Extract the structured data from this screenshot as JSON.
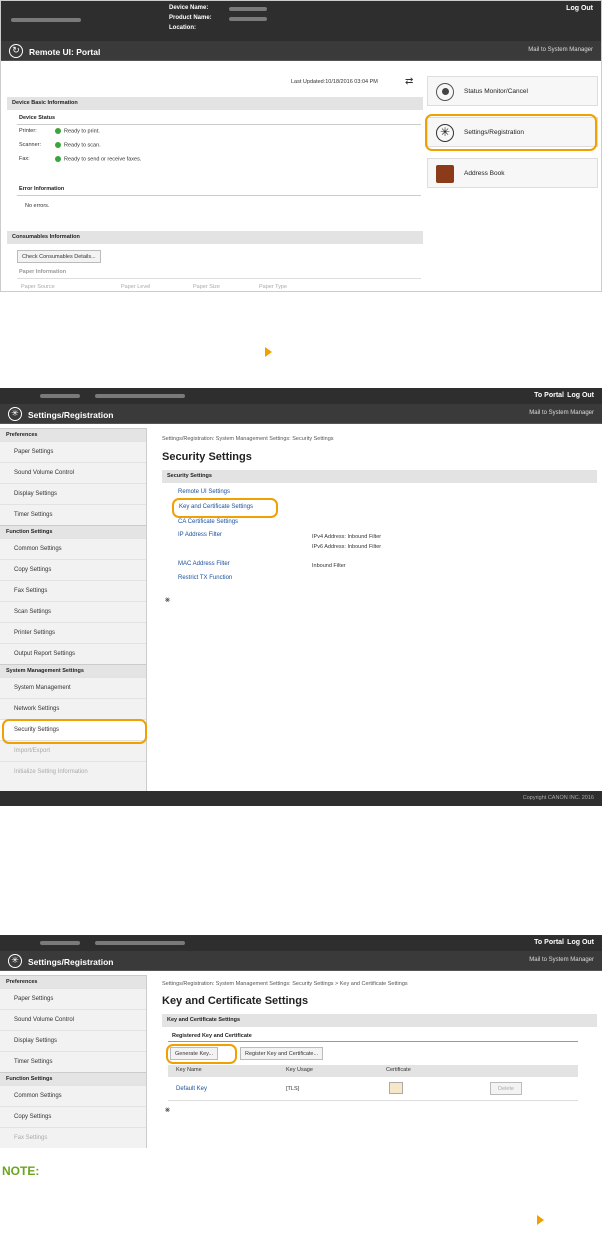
{
  "portal": {
    "device_name_label": "Device Name:",
    "product_name_label": "Product Name:",
    "location_label": "Location:",
    "logout": "Log Out",
    "title": "Remote UI: Portal",
    "mail": "Mail to System Manager",
    "last_updated": "Last Updated:10/18/2016 03:04 PM",
    "device_basic_info": "Device Basic Information",
    "device_status": "Device Status",
    "printer_label": "Printer:",
    "printer_status": "Ready to print.",
    "scanner_label": "Scanner:",
    "scanner_status": "Ready to scan.",
    "fax_label": "Fax:",
    "fax_status": "Ready to send or receive faxes.",
    "error_info": "Error Information",
    "no_errors": "No errors.",
    "consumables_info": "Consumables Information",
    "check_consumables": "Check Consumables Details...",
    "paper_info": "Paper Information",
    "paper_cols": [
      "Paper Source",
      "Paper Level",
      "Paper Size",
      "Paper Type"
    ],
    "status_monitor": "Status Monitor/Cancel",
    "settings_registration": "Settings/Registration",
    "address_book": "Address Book"
  },
  "settings": {
    "to_portal": "To Portal",
    "logout": "Log Out",
    "title": "Settings/Registration",
    "mail": "Mail to System Manager",
    "breadcrumb": "Settings/Registration: System Management Settings: Security Settings",
    "heading": "Security Settings",
    "section": "Security Settings",
    "links": [
      "Remote UI Settings",
      "Key and Certificate Settings",
      "CA Certificate Settings",
      "IP Address Filter",
      "MAC Address Filter",
      "Restrict TX Function"
    ],
    "ip_filter_notes": [
      "IPv4 Address: Inbound Filter",
      "IPv6 Address: Inbound Filter"
    ],
    "mac_filter_note": "Inbound Filter",
    "copyright": "Copyright CANON INC. 2016"
  },
  "sidebar": {
    "preferences": "Preferences",
    "pref_items": [
      "Paper Settings",
      "Sound Volume Control",
      "Display Settings",
      "Timer Settings"
    ],
    "function_settings": "Function Settings",
    "func_items": [
      "Common Settings",
      "Copy Settings",
      "Fax Settings",
      "Scan Settings",
      "Printer Settings",
      "Output Report Settings"
    ],
    "system_settings": "System Management Settings",
    "sys_items": [
      "System Management",
      "Network Settings",
      "Security Settings",
      "Import/Export",
      "Initialize Setting Information"
    ]
  },
  "keycert": {
    "breadcrumb": "Settings/Registration: System Management Settings: Security Settings > Key and Certificate Settings",
    "heading": "Key and Certificate Settings",
    "section": "Key and Certificate Settings",
    "registered": "Registered Key and Certificate",
    "generate": "Generate Key...",
    "register": "Register Key and Certificate...",
    "cols": [
      "Key Name",
      "Key Usage",
      "Certificate"
    ],
    "row": {
      "name": "Default Key",
      "usage": "[TLS]",
      "delete": "Delete"
    }
  },
  "note": "NOTE:",
  "colors": {
    "accent": "#f0a000",
    "note": "#6aa51e",
    "link": "#1a4f9c"
  }
}
